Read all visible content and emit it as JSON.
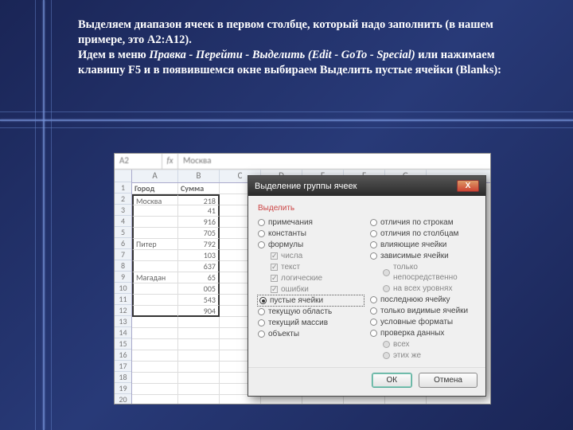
{
  "instruction": {
    "p1a": "Выделяем диапазон ячеек в первом столбце, который надо заполнить (в нашем примере, это A2:A12).",
    "p2a": "Идем в меню ",
    "p2i": "Правка - Перейти - Выделить (Edit - GoTo - Special)",
    "p2b": " или нажимаем клавишу F5 и в появившемся окне выбираем Выделить пустые ячейки (Blanks):"
  },
  "spreadsheet": {
    "namebox": "A2",
    "fx": "fx",
    "formula_value": "Москва",
    "col_letters": [
      "A",
      "B",
      "C",
      "D",
      "E",
      "F",
      "G"
    ],
    "row_numbers_count": 20,
    "headers": {
      "A": "Город",
      "B": "Сумма"
    },
    "cells": {
      "A2": "Москва",
      "B2": "218",
      "B3": "41",
      "B4": "916",
      "B5": "705",
      "A6": "Питер",
      "B6": "792",
      "B7": "103",
      "B8": "637",
      "A9": "Магадан",
      "B9": "65",
      "B10": "005",
      "B11": "543",
      "B12": "904"
    }
  },
  "dialog": {
    "title": "Выделение группы ячеек",
    "section": "Выделить",
    "left_options": [
      {
        "t": "radio",
        "label": "примечания"
      },
      {
        "t": "radio",
        "label": "константы"
      },
      {
        "t": "radio",
        "label": "формулы"
      },
      {
        "t": "check",
        "label": "числа",
        "indent": true,
        "on": true,
        "dis": true
      },
      {
        "t": "check",
        "label": "текст",
        "indent": true,
        "on": true,
        "dis": true
      },
      {
        "t": "check",
        "label": "логические",
        "indent": true,
        "on": true,
        "dis": true
      },
      {
        "t": "check",
        "label": "ошибки",
        "indent": true,
        "on": true,
        "dis": true
      },
      {
        "t": "radio",
        "label": "пустые ячейки",
        "sel": true,
        "box": true
      },
      {
        "t": "radio",
        "label": "текущую область"
      },
      {
        "t": "radio",
        "label": "текущий массив"
      },
      {
        "t": "radio",
        "label": "объекты"
      }
    ],
    "right_options": [
      {
        "t": "radio",
        "label": "отличия по строкам"
      },
      {
        "t": "radio",
        "label": "отличия по столбцам"
      },
      {
        "t": "radio",
        "label": "влияющие ячейки"
      },
      {
        "t": "radio",
        "label": "зависимые ячейки"
      },
      {
        "t": "radio",
        "label": "только непосредственно",
        "indent": true,
        "dis": true
      },
      {
        "t": "radio",
        "label": "на всех уровнях",
        "indent": true,
        "dis": true
      },
      {
        "t": "radio",
        "label": "последнюю ячейку"
      },
      {
        "t": "radio",
        "label": "только видимые ячейки"
      },
      {
        "t": "radio",
        "label": "условные форматы"
      },
      {
        "t": "radio",
        "label": "проверка данных"
      },
      {
        "t": "radio",
        "label": "всех",
        "indent": true,
        "dis": true
      },
      {
        "t": "radio",
        "label": "этих же",
        "indent": true,
        "dis": true
      }
    ],
    "ok": "ОК",
    "cancel": "Отмена"
  }
}
